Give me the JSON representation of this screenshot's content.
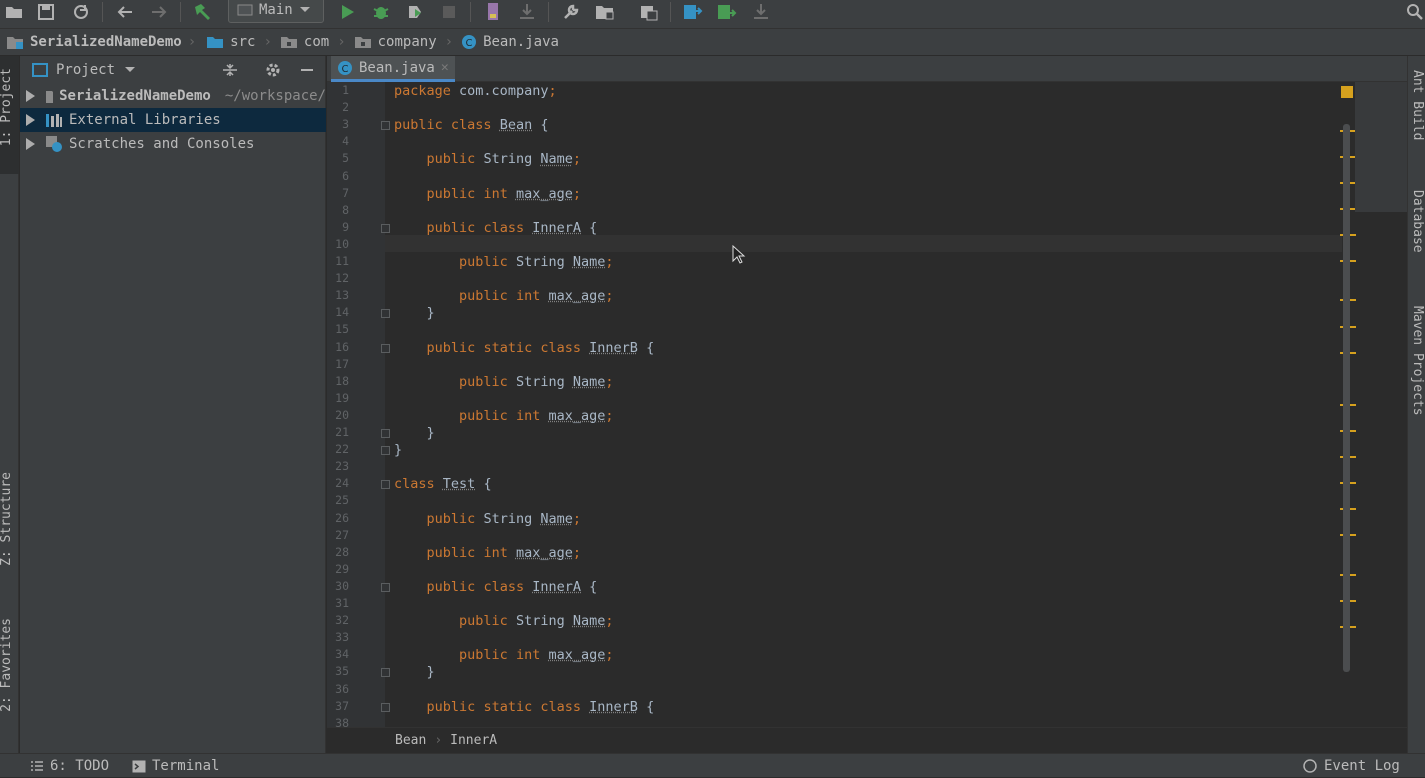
{
  "toolbar": {
    "run_config": "Main",
    "icons": [
      "open-folder-icon",
      "save-icon",
      "sync-icon",
      "back-icon",
      "forward-icon",
      "build-hammer-icon",
      "run-icon",
      "debug-icon",
      "coverage-icon",
      "stop-icon",
      "profile-icon",
      "update-icon",
      "settings-wrench-icon",
      "project-structure-icon",
      "sdk-icon",
      "vcs-update-icon",
      "vcs-commit-icon",
      "vcs-push-icon",
      "search-icon"
    ]
  },
  "breadcrumb": {
    "project": "SerializedNameDemo",
    "items": [
      "src",
      "com",
      "company",
      "Bean.java"
    ]
  },
  "left_strip": {
    "project": "1: Project",
    "structure": "Z: Structure",
    "favorites": "2: Favorites"
  },
  "right_strip": {
    "ant": "Ant Build",
    "database": "Database",
    "maven": "Maven Projects"
  },
  "project_panel": {
    "title": "Project",
    "tree": [
      {
        "label": "SerializedNameDemo",
        "path": "~/workspace/",
        "bold": true
      },
      {
        "label": "External Libraries",
        "selected": true
      },
      {
        "label": "Scratches and Consoles"
      }
    ]
  },
  "editor": {
    "tab": "Bean.java",
    "lines": [
      "package com.company;",
      "",
      "public class Bean {",
      "",
      "    public String Name;",
      "",
      "    public int max_age;",
      "",
      "    public class InnerA {",
      "",
      "        public String Name;",
      "",
      "        public int max_age;",
      "    }",
      "",
      "    public static class InnerB {",
      "",
      "        public String Name;",
      "",
      "        public int max_age;",
      "    }",
      "}",
      "",
      "class Test {",
      "",
      "    public String Name;",
      "",
      "    public int max_age;",
      "",
      "    public class InnerA {",
      "",
      "        public String Name;",
      "",
      "        public int max_age;",
      "    }",
      "",
      "    public static class InnerB {",
      ""
    ],
    "line_numbers": [
      "1",
      "2",
      "3",
      "4",
      "5",
      "6",
      "7",
      "8",
      "9",
      "10",
      "11",
      "12",
      "13",
      "14",
      "15",
      "16",
      "17",
      "18",
      "19",
      "20",
      "21",
      "22",
      "23",
      "24",
      "25",
      "26",
      "27",
      "28",
      "29",
      "30",
      "31",
      "32",
      "33",
      "34",
      "35",
      "36",
      "37",
      "38"
    ],
    "breadcrumb": [
      "Bean",
      "InnerA"
    ]
  },
  "status_bar": {
    "todo": "6: TODO",
    "terminal": "Terminal",
    "event_log": "Event Log"
  },
  "colors": {
    "keyword": "#cc7832",
    "text": "#a9b7c6",
    "selection": "#0d293e",
    "accent": "#4a88c7",
    "marker": "#d6a11e"
  }
}
